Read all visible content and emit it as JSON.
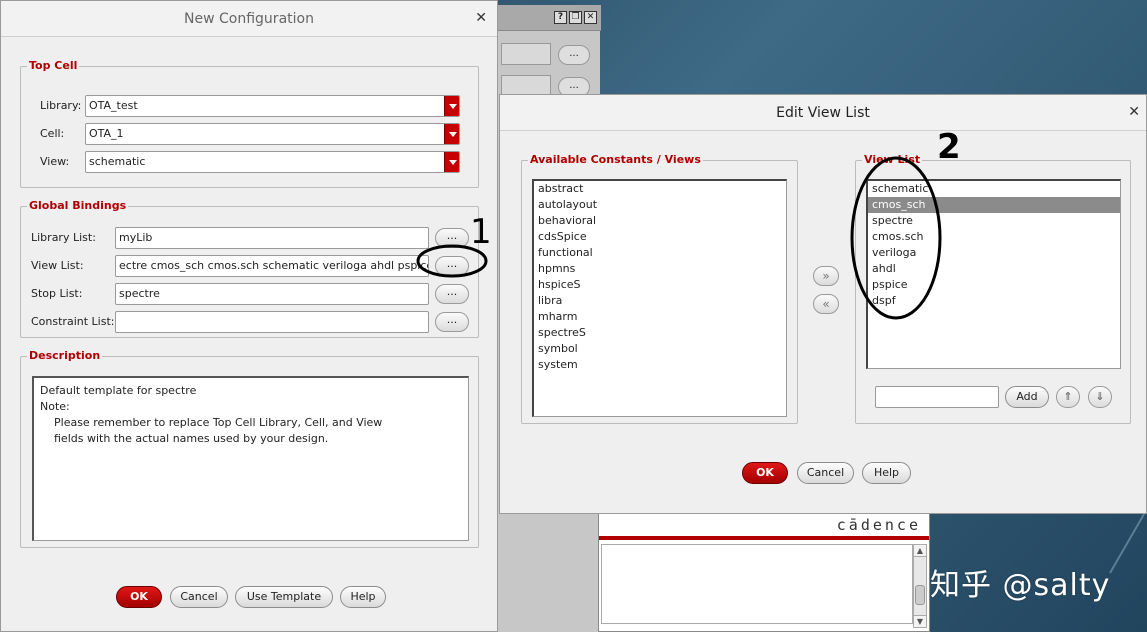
{
  "watermark": "知乎 @salty",
  "cadence_logo": "cādence",
  "new_config": {
    "title": "New Configuration",
    "top_cell": {
      "group_title": "Top Cell",
      "library_label": "Library:",
      "library_value": "OTA_test",
      "cell_label": "Cell:",
      "cell_value": "OTA_1",
      "view_label": "View:",
      "view_value": "schematic"
    },
    "global_bindings": {
      "group_title": "Global Bindings",
      "library_list_label": "Library List:",
      "library_list_value": "myLib",
      "view_list_label": "View List:",
      "view_list_value": "ectre cmos_sch cmos.sch schematic veriloga ahdl pspice dspf",
      "stop_list_label": "Stop List:",
      "stop_list_value": "spectre",
      "constraint_list_label": "Constraint List:",
      "constraint_list_value": "",
      "browse_label": "..."
    },
    "description": {
      "group_title": "Description",
      "line1": "Default template for spectre",
      "line2": "Note:",
      "line3": "Please remember to replace Top Cell Library, Cell, and View",
      "line4": "fields with the actual names used by your design."
    },
    "buttons": {
      "ok": "OK",
      "cancel": "Cancel",
      "use_template": "Use Template",
      "help": "Help"
    }
  },
  "edit_view_list": {
    "title": "Edit View List",
    "available_title": "Available Constants / Views",
    "available": [
      "abstract",
      "autolayout",
      "behavioral",
      "cdsSpice",
      "functional",
      "hpmns",
      "hspiceS",
      "libra",
      "mharm",
      "spectreS",
      "symbol",
      "system"
    ],
    "view_list_title": "View List",
    "view_list": [
      "schematic",
      "cmos_sch",
      "spectre",
      "cmos.sch",
      "veriloga",
      "ahdl",
      "pspice",
      "dspf"
    ],
    "selected_index": 1,
    "add_input_value": "",
    "add_label": "Add",
    "buttons": {
      "ok": "OK",
      "cancel": "Cancel",
      "help": "Help"
    }
  },
  "annotations": {
    "mark1": "1",
    "mark2": "2"
  },
  "colors": {
    "accent_red": "#c40000",
    "group_title_red": "#b00000",
    "selection_gray": "#8b8b8b"
  }
}
